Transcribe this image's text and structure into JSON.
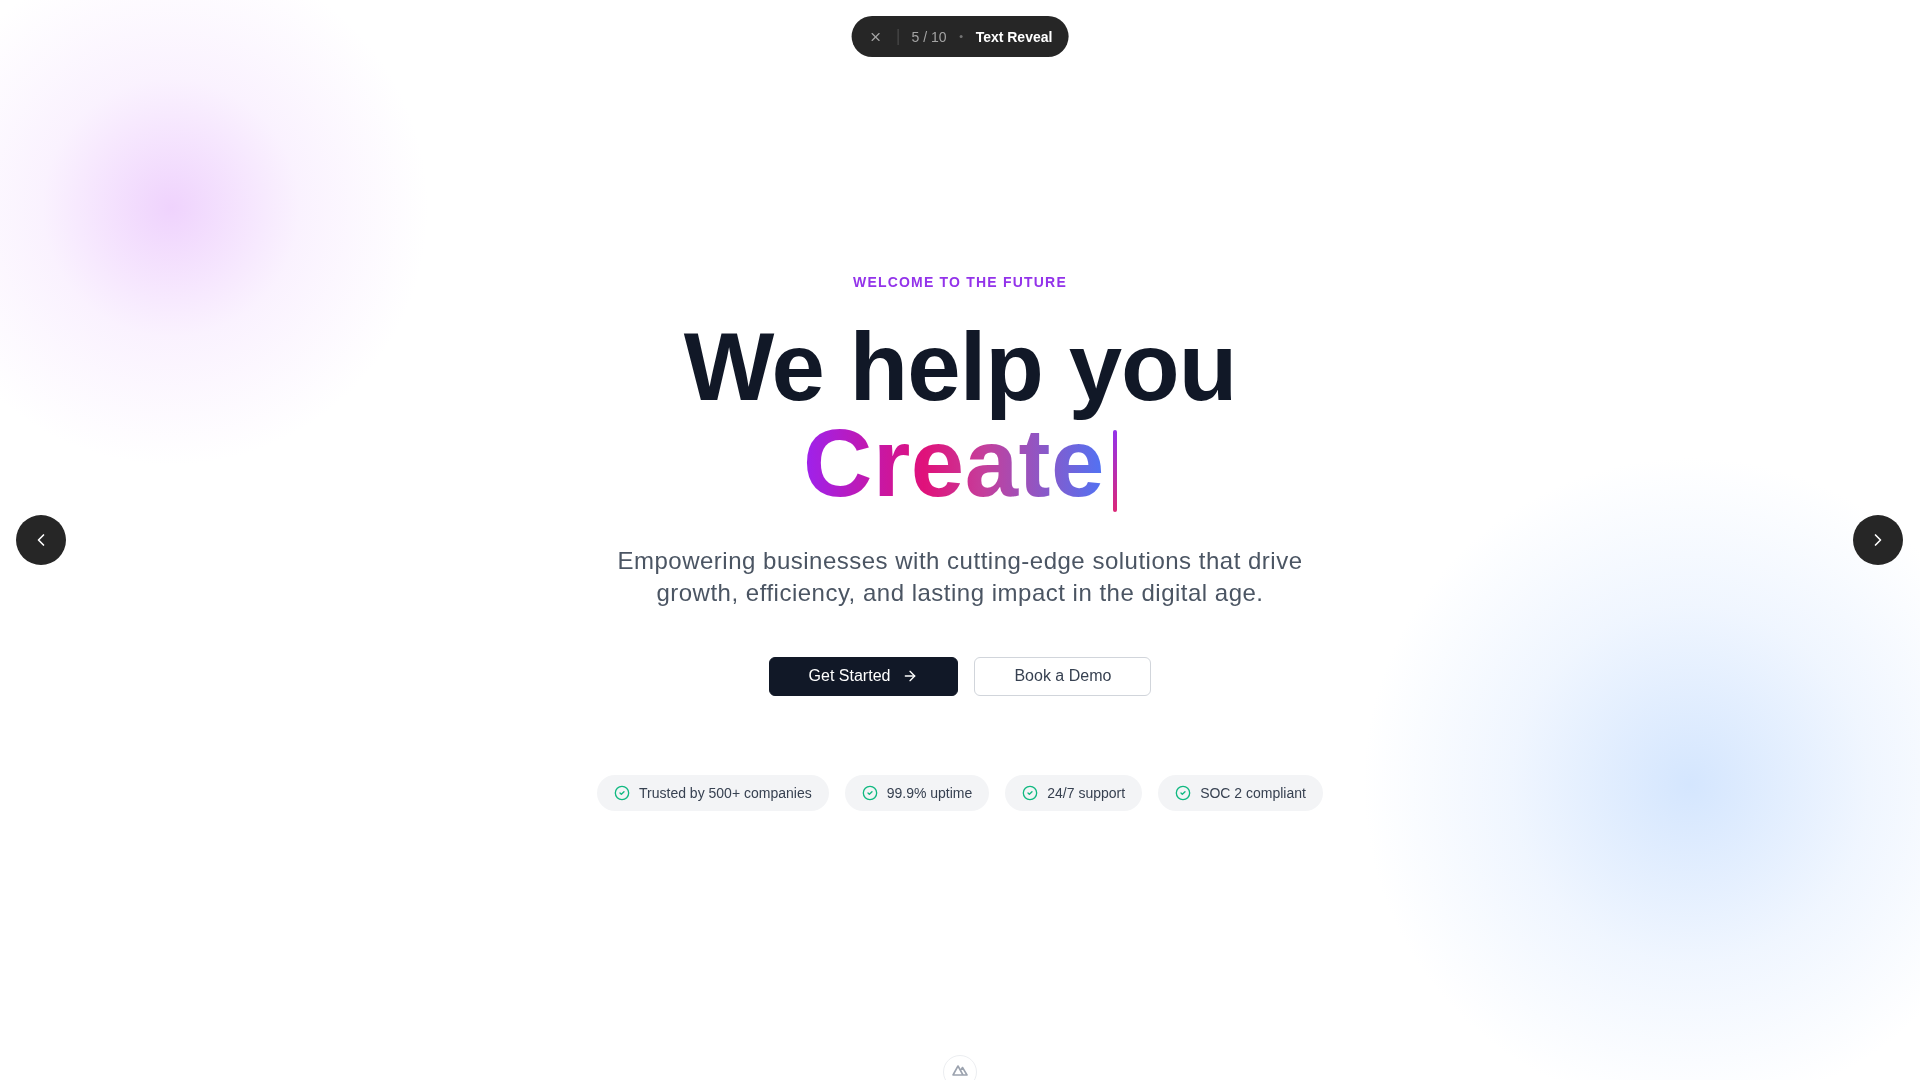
{
  "slide_indicator": {
    "counter": "5 / 10",
    "title": "Text Reveal"
  },
  "hero": {
    "eyebrow": "WELCOME TO THE FUTURE",
    "headline": "We help you",
    "highlight": "Create",
    "subtitle": "Empowering businesses with cutting-edge solutions that drive growth, efficiency, and lasting impact in the digital age.",
    "buttons": [
      {
        "label": "Get Started",
        "kind": "primary"
      },
      {
        "label": "Book a Demo",
        "kind": "secondary"
      }
    ],
    "badges": [
      "Trusted by 500+ companies",
      "99.9% uptime",
      "24/7 support",
      "SOC 2 compliant"
    ]
  }
}
